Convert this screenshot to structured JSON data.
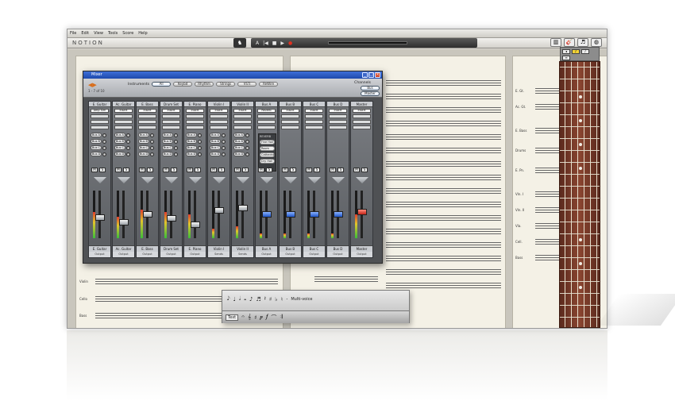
{
  "menu": [
    "File",
    "Edit",
    "View",
    "Tools",
    "Score",
    "Help"
  ],
  "app_name": "NOTION",
  "transport": {
    "buttons": [
      "A",
      "|◀",
      "■",
      "▶",
      "●"
    ]
  },
  "mixer": {
    "title": "Mixer",
    "page_indicator": "1 - 7 of 10",
    "instruments_label": "Instruments",
    "filters": [
      "All",
      "Keybd",
      "Rhythm",
      "Strings",
      "VSTi",
      "ReWire"
    ],
    "channels_label": "Channels",
    "channel_buttons": [
      "Bus",
      "Master"
    ],
    "strips": [
      {
        "name": "E. Guitar",
        "insert": "Amp Sim",
        "out": "Output",
        "fader": 0.42,
        "meter": 0.55,
        "cap": "silver"
      },
      {
        "name": "Ac. Guitar",
        "insert": "Insert",
        "out": "Output",
        "fader": 0.3,
        "meter": 0.45,
        "cap": "silver"
      },
      {
        "name": "E. Bass",
        "insert": "Insert",
        "out": "Output",
        "fader": 0.5,
        "meter": 0.6,
        "cap": "silver"
      },
      {
        "name": "Drum Set",
        "insert": "Insert",
        "out": "Output",
        "fader": 0.4,
        "meter": 0.55,
        "cap": "silver"
      },
      {
        "name": "E. Piano",
        "insert": "Insert",
        "out": "Output",
        "fader": 0.25,
        "meter": 0.5,
        "cap": "silver"
      },
      {
        "name": "Violin I",
        "insert": "Insert",
        "out": "Sends",
        "fader": 0.6,
        "meter": 0.2,
        "cap": "silver"
      },
      {
        "name": "Violin II",
        "insert": "Insert",
        "out": "Sends",
        "fader": 0.65,
        "meter": 0.25,
        "cap": "silver"
      },
      {
        "name": "Bus A",
        "insert": "Reverb",
        "out": "Output",
        "fader": 0.5,
        "meter": 0.1,
        "cap": "blue"
      },
      {
        "name": "Bus B",
        "insert": "Insert",
        "out": "Output",
        "fader": 0.5,
        "meter": 0.1,
        "cap": "blue"
      },
      {
        "name": "Bus C",
        "insert": "Insert",
        "out": "Output",
        "fader": 0.5,
        "meter": 0.1,
        "cap": "blue"
      },
      {
        "name": "Bus D",
        "insert": "Insert",
        "out": "Output",
        "fader": 0.5,
        "meter": 0.1,
        "cap": "blue"
      },
      {
        "name": "Master",
        "insert": "Insert",
        "out": "Output",
        "fader": 0.55,
        "meter": 0.5,
        "cap": "red"
      }
    ],
    "send_labels": [
      "Bus A",
      "Bus B",
      "Bus C",
      "Bus D"
    ],
    "mute_solo": [
      "M",
      "S"
    ],
    "reverb_title": "REVERB",
    "reverb_options": [
      "Fine Hall",
      "Room",
      "Cathedral",
      "Dry Hall"
    ]
  },
  "score": {
    "page1_labels": [
      "Violin",
      "Cello",
      "Bass"
    ],
    "page2_labels": [
      "E. Gt.",
      "Ac. Gt.",
      "E. Bass",
      "Drums",
      "E. Pn.",
      "Vln. I",
      "Vln. II",
      "Vla.",
      "Cell.",
      "Bass"
    ]
  },
  "palette": {
    "row1": [
      "𝅘𝅥𝅮",
      "♩",
      "𝅗𝅥",
      "𝅝",
      "♪",
      "♬",
      "𝄽",
      "♯",
      "♭",
      "♮",
      "·"
    ],
    "multi_voice": "Multi-voice",
    "tab_text": "Text",
    "row2": [
      "𝄐",
      "𝄞",
      "♯",
      "𝆏",
      "𝆑",
      "⌒",
      "𝄇"
    ]
  }
}
